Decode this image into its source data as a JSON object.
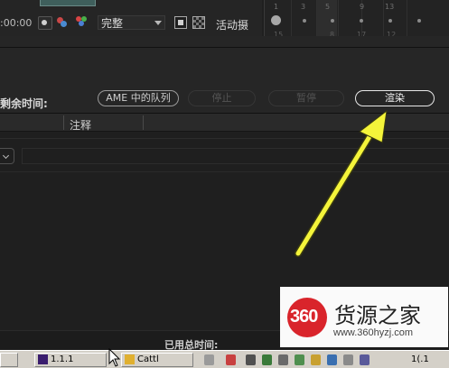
{
  "viewer": {
    "timecode": ":00:00",
    "resolution": "完整",
    "active_camera": "活动摄"
  },
  "key_panel": {
    "top_numbers": [
      "1",
      "3",
      "5",
      "9",
      "13"
    ],
    "bottom_numbers": [
      "15",
      "8",
      "17",
      "12"
    ]
  },
  "render_queue": {
    "remaining_time_label": "剩余时间:",
    "ame_queue_button": "AME 中的队列",
    "stop_button": "停止",
    "pause_button": "暂停",
    "render_button": "渲染",
    "columns": {
      "comment": "注释"
    },
    "total_time_label": "已用总时间:"
  },
  "annotation": {
    "arrow_color": "#f4f43a"
  },
  "watermark": {
    "logo_text": "360",
    "title": "货源之家",
    "url": "www.360hyzj.com",
    "brand_color": "#d9242b"
  },
  "taskbar": {
    "button_1": "1.1.1",
    "button_2": "Cattl",
    "clock": "1(.1"
  },
  "colors": {
    "accent_render": "#f0f0f0",
    "panel_bg": "#262626"
  }
}
